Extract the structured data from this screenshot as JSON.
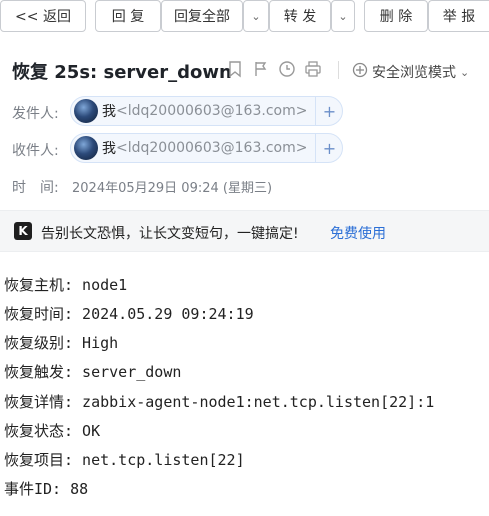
{
  "toolbar": {
    "back": "<< 返回",
    "reply": "回 复",
    "reply_all": "回复全部",
    "forward": "转 发",
    "delete": "删 除",
    "report": "举 报"
  },
  "subject": "恢复 25s: server_down",
  "safe_mode": "安全浏览模式",
  "header": {
    "from_label": "发件人:",
    "to_label": "收件人:",
    "time_label": "时　间:",
    "sender_name": "我",
    "sender_addr": "<ldq20000603@163.com>",
    "recipient_name": "我",
    "recipient_addr": "<ldq20000603@163.com>",
    "time": "2024年05月29日 09:24 (星期三)"
  },
  "banner": {
    "logo": "K",
    "text": "告别长文恐惧，让长文变短句，一键搞定!",
    "link": "免费使用"
  },
  "body": [
    "恢复主机: node1",
    "恢复时间: 2024.05.29 09:24:19",
    "恢复级别: High",
    "恢复触发: server_down",
    "恢复详情: zabbix-agent-node1:net.tcp.listen[22]:1",
    "恢复状态: OK",
    "恢复项目: net.tcp.listen[22]",
    "事件ID: 88"
  ]
}
